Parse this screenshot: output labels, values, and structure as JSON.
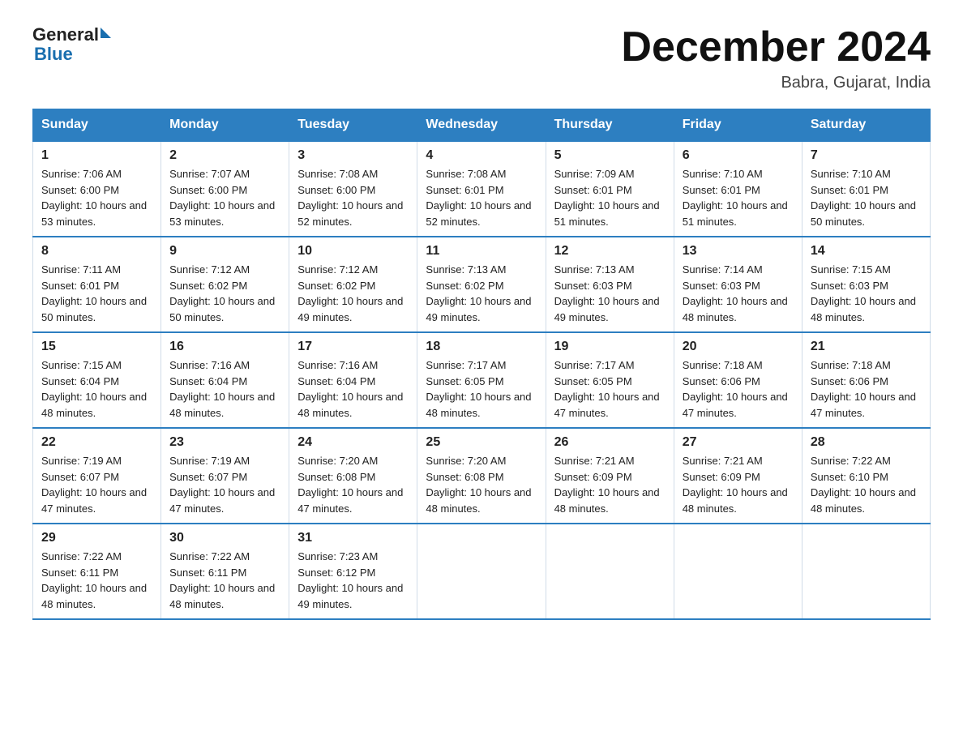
{
  "header": {
    "logo_line1": "General",
    "logo_line2": "Blue",
    "month_title": "December 2024",
    "location": "Babra, Gujarat, India"
  },
  "days_of_week": [
    "Sunday",
    "Monday",
    "Tuesday",
    "Wednesday",
    "Thursday",
    "Friday",
    "Saturday"
  ],
  "weeks": [
    [
      {
        "day": "1",
        "sunrise": "7:06 AM",
        "sunset": "6:00 PM",
        "daylight": "10 hours and 53 minutes."
      },
      {
        "day": "2",
        "sunrise": "7:07 AM",
        "sunset": "6:00 PM",
        "daylight": "10 hours and 53 minutes."
      },
      {
        "day": "3",
        "sunrise": "7:08 AM",
        "sunset": "6:00 PM",
        "daylight": "10 hours and 52 minutes."
      },
      {
        "day": "4",
        "sunrise": "7:08 AM",
        "sunset": "6:01 PM",
        "daylight": "10 hours and 52 minutes."
      },
      {
        "day": "5",
        "sunrise": "7:09 AM",
        "sunset": "6:01 PM",
        "daylight": "10 hours and 51 minutes."
      },
      {
        "day": "6",
        "sunrise": "7:10 AM",
        "sunset": "6:01 PM",
        "daylight": "10 hours and 51 minutes."
      },
      {
        "day": "7",
        "sunrise": "7:10 AM",
        "sunset": "6:01 PM",
        "daylight": "10 hours and 50 minutes."
      }
    ],
    [
      {
        "day": "8",
        "sunrise": "7:11 AM",
        "sunset": "6:01 PM",
        "daylight": "10 hours and 50 minutes."
      },
      {
        "day": "9",
        "sunrise": "7:12 AM",
        "sunset": "6:02 PM",
        "daylight": "10 hours and 50 minutes."
      },
      {
        "day": "10",
        "sunrise": "7:12 AM",
        "sunset": "6:02 PM",
        "daylight": "10 hours and 49 minutes."
      },
      {
        "day": "11",
        "sunrise": "7:13 AM",
        "sunset": "6:02 PM",
        "daylight": "10 hours and 49 minutes."
      },
      {
        "day": "12",
        "sunrise": "7:13 AM",
        "sunset": "6:03 PM",
        "daylight": "10 hours and 49 minutes."
      },
      {
        "day": "13",
        "sunrise": "7:14 AM",
        "sunset": "6:03 PM",
        "daylight": "10 hours and 48 minutes."
      },
      {
        "day": "14",
        "sunrise": "7:15 AM",
        "sunset": "6:03 PM",
        "daylight": "10 hours and 48 minutes."
      }
    ],
    [
      {
        "day": "15",
        "sunrise": "7:15 AM",
        "sunset": "6:04 PM",
        "daylight": "10 hours and 48 minutes."
      },
      {
        "day": "16",
        "sunrise": "7:16 AM",
        "sunset": "6:04 PM",
        "daylight": "10 hours and 48 minutes."
      },
      {
        "day": "17",
        "sunrise": "7:16 AM",
        "sunset": "6:04 PM",
        "daylight": "10 hours and 48 minutes."
      },
      {
        "day": "18",
        "sunrise": "7:17 AM",
        "sunset": "6:05 PM",
        "daylight": "10 hours and 48 minutes."
      },
      {
        "day": "19",
        "sunrise": "7:17 AM",
        "sunset": "6:05 PM",
        "daylight": "10 hours and 47 minutes."
      },
      {
        "day": "20",
        "sunrise": "7:18 AM",
        "sunset": "6:06 PM",
        "daylight": "10 hours and 47 minutes."
      },
      {
        "day": "21",
        "sunrise": "7:18 AM",
        "sunset": "6:06 PM",
        "daylight": "10 hours and 47 minutes."
      }
    ],
    [
      {
        "day": "22",
        "sunrise": "7:19 AM",
        "sunset": "6:07 PM",
        "daylight": "10 hours and 47 minutes."
      },
      {
        "day": "23",
        "sunrise": "7:19 AM",
        "sunset": "6:07 PM",
        "daylight": "10 hours and 47 minutes."
      },
      {
        "day": "24",
        "sunrise": "7:20 AM",
        "sunset": "6:08 PM",
        "daylight": "10 hours and 47 minutes."
      },
      {
        "day": "25",
        "sunrise": "7:20 AM",
        "sunset": "6:08 PM",
        "daylight": "10 hours and 48 minutes."
      },
      {
        "day": "26",
        "sunrise": "7:21 AM",
        "sunset": "6:09 PM",
        "daylight": "10 hours and 48 minutes."
      },
      {
        "day": "27",
        "sunrise": "7:21 AM",
        "sunset": "6:09 PM",
        "daylight": "10 hours and 48 minutes."
      },
      {
        "day": "28",
        "sunrise": "7:22 AM",
        "sunset": "6:10 PM",
        "daylight": "10 hours and 48 minutes."
      }
    ],
    [
      {
        "day": "29",
        "sunrise": "7:22 AM",
        "sunset": "6:11 PM",
        "daylight": "10 hours and 48 minutes."
      },
      {
        "day": "30",
        "sunrise": "7:22 AM",
        "sunset": "6:11 PM",
        "daylight": "10 hours and 48 minutes."
      },
      {
        "day": "31",
        "sunrise": "7:23 AM",
        "sunset": "6:12 PM",
        "daylight": "10 hours and 49 minutes."
      },
      null,
      null,
      null,
      null
    ]
  ]
}
